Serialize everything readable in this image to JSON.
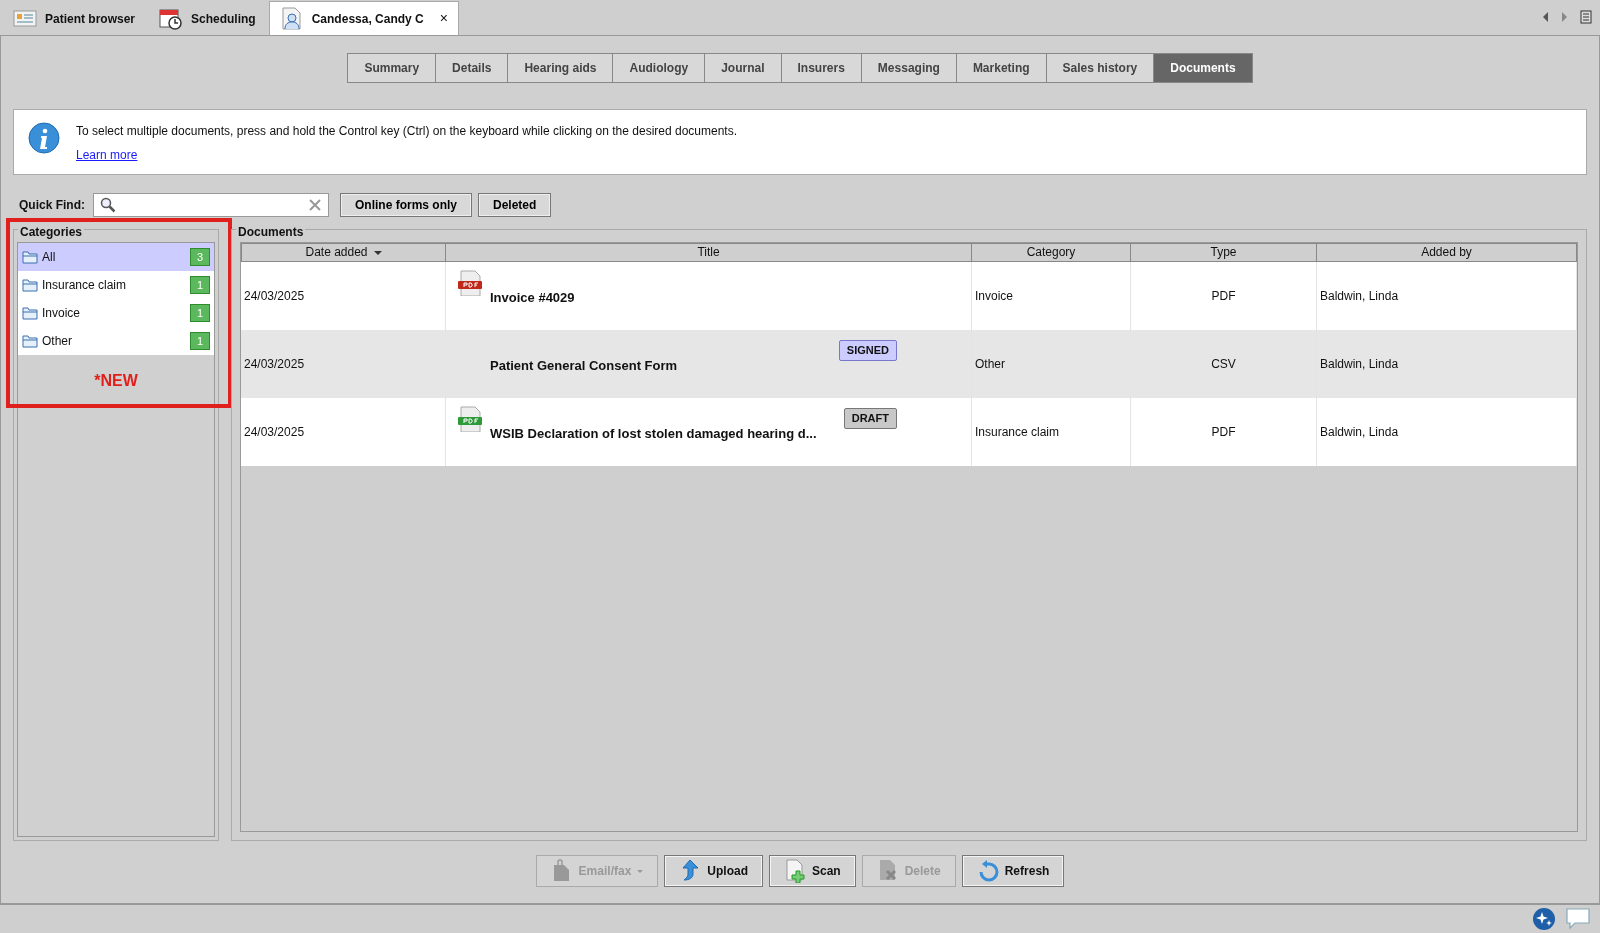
{
  "top_tabs": [
    {
      "label": "Patient browser",
      "selected": false
    },
    {
      "label": "Scheduling",
      "selected": false
    },
    {
      "label": "Candessa, Candy C",
      "selected": true,
      "close": "×"
    }
  ],
  "sub_tabs": [
    {
      "label": "Summary",
      "selected": false
    },
    {
      "label": "Details",
      "selected": false
    },
    {
      "label": "Hearing aids",
      "selected": false
    },
    {
      "label": "Audiology",
      "selected": false
    },
    {
      "label": "Journal",
      "selected": false
    },
    {
      "label": "Insurers",
      "selected": false
    },
    {
      "label": "Messaging",
      "selected": false
    },
    {
      "label": "Marketing",
      "selected": false
    },
    {
      "label": "Sales history",
      "selected": false
    },
    {
      "label": "Documents",
      "selected": true
    }
  ],
  "info": {
    "message": "To select multiple documents, press and hold the Control key (Ctrl) on the keyboard while clicking on the desired documents.",
    "link": "Learn more"
  },
  "quick_find": {
    "label": "Quick Find:"
  },
  "filter_buttons": [
    "Online forms only",
    "Deleted"
  ],
  "categories": {
    "title": "Categories",
    "items": [
      {
        "label": "All",
        "count": "3",
        "selected": true
      },
      {
        "label": "Insurance claim",
        "count": "1",
        "selected": false
      },
      {
        "label": "Invoice",
        "count": "1",
        "selected": false
      },
      {
        "label": "Other",
        "count": "1",
        "selected": false
      }
    ],
    "annotation": "*NEW"
  },
  "documents": {
    "title": "Documents",
    "columns": [
      {
        "label": "Date added",
        "sorted": true
      },
      {
        "label": "Title",
        "sorted": false
      },
      {
        "label": "Category",
        "sorted": false
      },
      {
        "label": "Type",
        "sorted": false
      },
      {
        "label": "Added by",
        "sorted": false
      }
    ],
    "rows": [
      {
        "date": "24/03/2025",
        "kind": "pdf_red",
        "title": "Invoice #4029",
        "badge": null,
        "category": "Invoice",
        "type": "PDF",
        "added_by": "Baldwin, Linda",
        "shaded": false
      },
      {
        "date": "24/03/2025",
        "kind": "plain",
        "title": "Patient General Consent Form",
        "badge": {
          "text": "SIGNED",
          "kind": "signed"
        },
        "category": "Other",
        "type": "CSV",
        "added_by": "Baldwin, Linda",
        "shaded": true
      },
      {
        "date": "24/03/2025",
        "kind": "pdf_green",
        "title": "WSIB Declaration of lost stolen damaged hearing d...",
        "badge": {
          "text": "DRAFT",
          "kind": "draft"
        },
        "category": "Insurance claim",
        "type": "PDF",
        "added_by": "Baldwin, Linda",
        "shaded": false
      }
    ]
  },
  "actions": [
    {
      "label": "Email/fax",
      "disabled": true,
      "dropdown": true
    },
    {
      "label": "Upload",
      "disabled": false,
      "dropdown": false
    },
    {
      "label": "Scan",
      "disabled": false,
      "dropdown": false
    },
    {
      "label": "Delete",
      "disabled": true,
      "dropdown": false
    },
    {
      "label": "Refresh",
      "disabled": false,
      "dropdown": false
    }
  ]
}
